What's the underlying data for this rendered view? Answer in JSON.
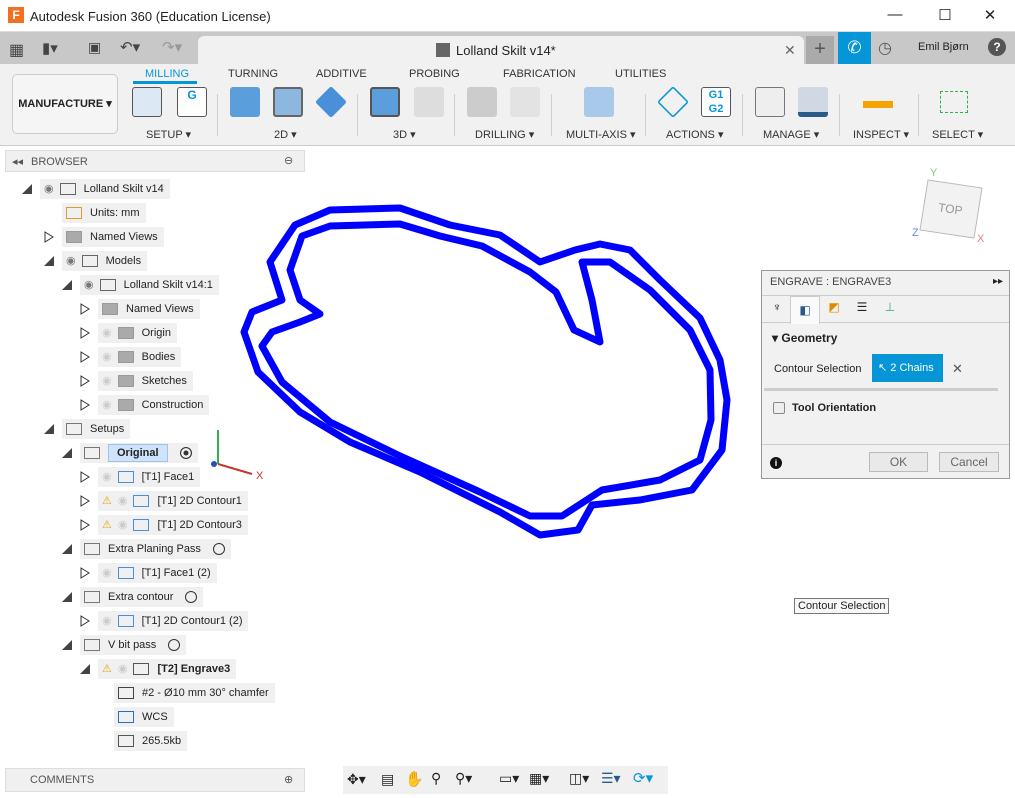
{
  "window": {
    "title": "Autodesk Fusion 360 (Education License)",
    "minimize": "—",
    "maximize": "☐",
    "close": "✕"
  },
  "doc_tab": {
    "name": "Lolland Skilt v14*",
    "close": "✕"
  },
  "user": {
    "name": "Emil Bjørn"
  },
  "workspace": "MANUFACTURE ▾",
  "ribbon_tabs": [
    "MILLING",
    "TURNING",
    "ADDITIVE",
    "PROBING",
    "FABRICATION",
    "UTILITIES"
  ],
  "ribbon_groups": [
    "SETUP ▾",
    "2D ▾",
    "3D ▾",
    "DRILLING ▾",
    "MULTI-AXIS ▾",
    "ACTIONS ▾",
    "MANAGE ▾",
    "INSPECT ▾",
    "SELECT ▾"
  ],
  "browser": {
    "title": "BROWSER",
    "items": [
      {
        "label": "Lolland Skilt v14",
        "level": 0,
        "state": "expanded",
        "icon": "component-icon",
        "eye": "visible"
      },
      {
        "label": "Units: mm",
        "level": 1,
        "state": "none",
        "icon": "document-icon"
      },
      {
        "label": "Named Views",
        "level": 1,
        "state": "collapsed",
        "icon": "folder-icon"
      },
      {
        "label": "Models",
        "level": 1,
        "state": "expanded",
        "icon": "component-icon",
        "eye": "visible"
      },
      {
        "label": "Lolland Skilt v14:1",
        "level": 2,
        "state": "expanded",
        "icon": "body-icon",
        "eye": "visible"
      },
      {
        "label": "Named Views",
        "level": 3,
        "state": "collapsed",
        "icon": "folder-icon"
      },
      {
        "label": "Origin",
        "level": 3,
        "state": "collapsed",
        "icon": "folder-icon",
        "eye": "hidden"
      },
      {
        "label": "Bodies",
        "level": 3,
        "state": "collapsed",
        "icon": "folder-icon",
        "eye": "hidden"
      },
      {
        "label": "Sketches",
        "level": 3,
        "state": "collapsed",
        "icon": "folder-icon",
        "eye": "hidden"
      },
      {
        "label": "Construction",
        "level": 3,
        "state": "collapsed",
        "icon": "folder-icon",
        "eye": "hidden"
      },
      {
        "label": "Setups",
        "level": 1,
        "state": "expanded",
        "icon": "folder-open-icon"
      },
      {
        "label": "Original",
        "level": 2,
        "state": "expanded",
        "icon": "folder-open-icon",
        "radio": "filled",
        "selected": true
      },
      {
        "label": "[T1] Face1",
        "level": 3,
        "state": "collapsed",
        "icon": "face-op-icon",
        "eye": "hidden"
      },
      {
        "label": "[T1] 2D Contour1",
        "level": 3,
        "state": "collapsed",
        "icon": "contour-op-icon",
        "eye": "hidden",
        "warning": true
      },
      {
        "label": "[T1] 2D Contour3",
        "level": 3,
        "state": "collapsed",
        "icon": "contour-op-icon",
        "eye": "hidden",
        "warning": true
      },
      {
        "label": "Extra Planing Pass",
        "level": 2,
        "state": "expanded",
        "icon": "folder-open-icon",
        "radio": "empty"
      },
      {
        "label": "[T1] Face1 (2)",
        "level": 3,
        "state": "collapsed",
        "icon": "face-op-icon",
        "eye": "hidden"
      },
      {
        "label": "Extra contour",
        "level": 2,
        "state": "expanded",
        "icon": "folder-open-icon",
        "radio": "empty"
      },
      {
        "label": "[T1] 2D Contour1 (2)",
        "level": 3,
        "state": "collapsed",
        "icon": "contour-op-icon",
        "eye": "hidden"
      },
      {
        "label": "V bit pass",
        "level": 2,
        "state": "expanded",
        "icon": "folder-open-icon",
        "radio": "empty"
      },
      {
        "label": "[T2] Engrave3",
        "level": 3,
        "state": "expanded",
        "icon": "engrave-op-icon",
        "eye": "hidden",
        "warning": true,
        "bold": true
      },
      {
        "label": "#2 - Ø10 mm 30° chamfer",
        "level": 4,
        "state": "none",
        "icon": "tool-icon"
      },
      {
        "label": "WCS",
        "level": 4,
        "state": "none",
        "icon": "wcs-icon"
      },
      {
        "label": "265.5kb",
        "level": 4,
        "state": "none",
        "icon": "nc-size-icon"
      }
    ]
  },
  "comments": {
    "title": "COMMENTS"
  },
  "viewcube": {
    "face": "TOP",
    "x": "X",
    "y": "Y",
    "z": "Z"
  },
  "triad": {
    "x": "X"
  },
  "panel": {
    "title": "ENGRAVE : ENGRAVE3",
    "section_geometry": "Geometry",
    "contour_label": "Contour Selection",
    "chains": "2 Chains",
    "clear": "✕",
    "tool_orientation": "Tool Orientation",
    "tool_orientation_checked": false,
    "ok": "OK",
    "cancel": "Cancel",
    "info": "i"
  },
  "tooltip": "Contour Selection",
  "colors": {
    "toolpath": "#0000ff",
    "accent": "#0696d7",
    "selected_row": "#cfe3fb"
  }
}
